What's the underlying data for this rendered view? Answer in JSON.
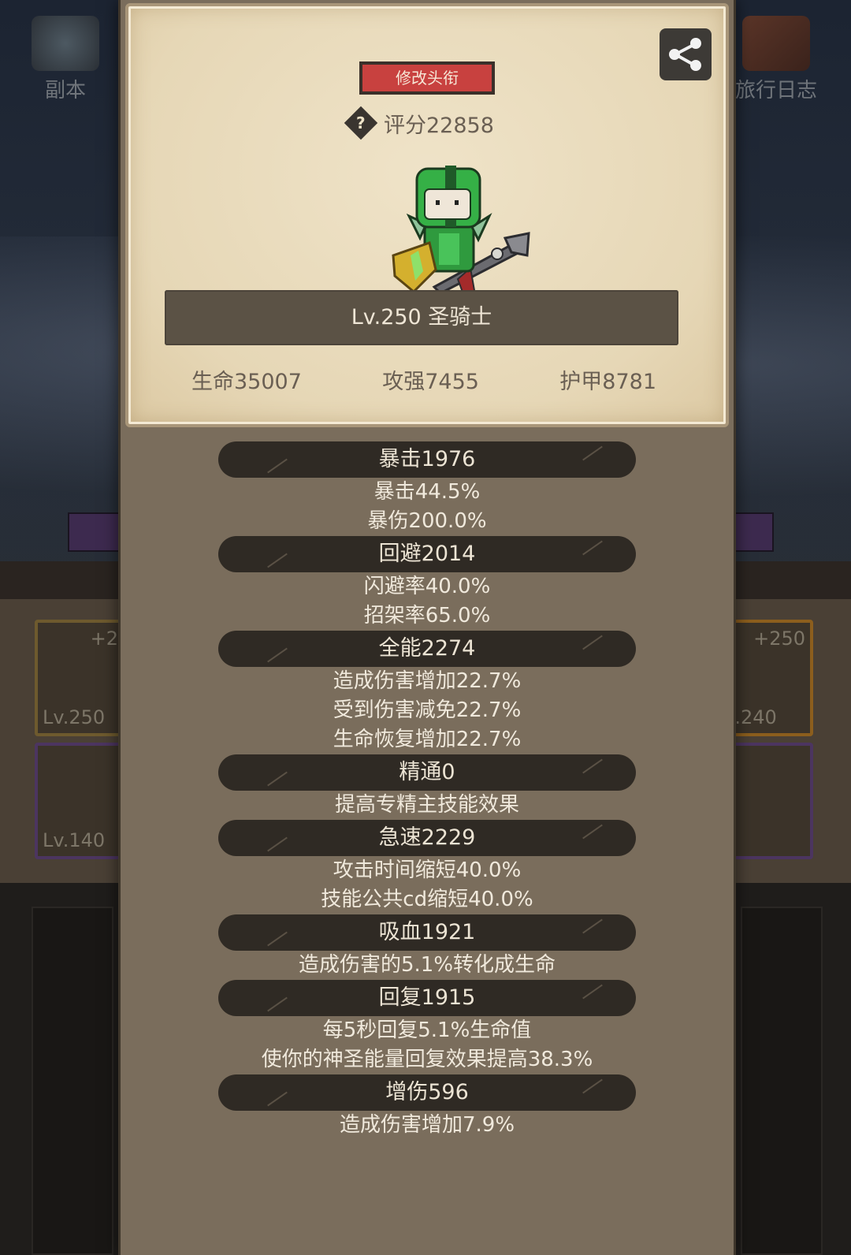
{
  "background": {
    "top_left_label": "副本",
    "top_right_label": "旅行日志",
    "slots": [
      {
        "plus": "+2",
        "level": "Lv.250"
      },
      {
        "plus": "",
        "level": "Lv.140"
      },
      {
        "plus": "+250",
        "level": "v.240"
      }
    ]
  },
  "header": {
    "title_button": "修改头衔",
    "score": "评分22858",
    "help_glyph": "?"
  },
  "hero": {
    "class_line": "Lv.250 圣骑士",
    "hp": "生命35007",
    "attack": "攻强7455",
    "armor": "护甲8781"
  },
  "stats": [
    {
      "title": "暴击1976",
      "lines": [
        "暴击44.5%",
        "暴伤200.0%"
      ]
    },
    {
      "title": "回避2014",
      "lines": [
        "闪避率40.0%",
        "招架率65.0%"
      ]
    },
    {
      "title": "全能2274",
      "lines": [
        "造成伤害增加22.7%",
        "受到伤害减免22.7%",
        "生命恢复增加22.7%"
      ]
    },
    {
      "title": "精通0",
      "lines": [
        "提高专精主技能效果"
      ]
    },
    {
      "title": "急速2229",
      "lines": [
        "攻击时间缩短40.0%",
        "技能公共cd缩短40.0%"
      ]
    },
    {
      "title": "吸血1921",
      "lines": [
        "造成伤害的5.1%转化成生命"
      ]
    },
    {
      "title": "回复1915",
      "lines": [
        "每5秒回复5.1%生命值",
        "使你的神圣能量回复效果提高38.3%"
      ]
    },
    {
      "title": "增伤596",
      "lines": [
        "造成伤害增加7.9%"
      ]
    }
  ],
  "icons": {
    "share": "share-icon",
    "help": "help-icon",
    "hero": "paladin-character-icon"
  },
  "colors": {
    "title_button": "#c8413f",
    "parchment": "#e6d7b6",
    "stat_pill": "#2f2a24",
    "dialog": "#7a6d5c"
  }
}
